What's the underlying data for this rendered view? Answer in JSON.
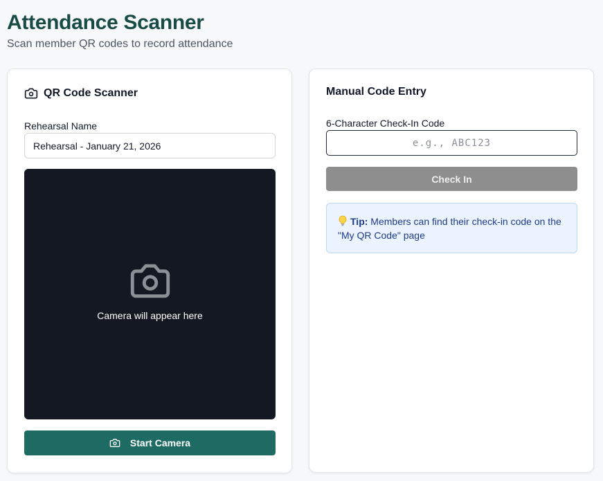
{
  "header": {
    "title": "Attendance Scanner",
    "subtitle": "Scan member QR codes to record attendance"
  },
  "scanner": {
    "title": "QR Code Scanner",
    "rehearsal_label": "Rehearsal Name",
    "rehearsal_value": "Rehearsal - January 21, 2026",
    "camera_placeholder": "Camera will appear here",
    "start_button": "Start Camera"
  },
  "manual": {
    "title": "Manual Code Entry",
    "code_label": "6-Character Check-In Code",
    "code_placeholder": "e.g., ABC123",
    "code_value": "",
    "checkin_button": "Check In",
    "tip_label": "Tip:",
    "tip_text": "Members can find their check-in code on the \"My QR Code\" page"
  },
  "icons": {
    "card_header_icon": "camera-icon",
    "camera_placeholder_icon": "camera-icon",
    "start_button_icon": "camera-icon",
    "tip_icon": "lightbulb-icon"
  },
  "colors": {
    "title": "#184b45",
    "primary": "#1d6b63",
    "camera_bg": "#141823",
    "disabled": "#8e8e8e",
    "tip_bg": "#eaf3fe",
    "tip_text": "#1e3a8a"
  }
}
